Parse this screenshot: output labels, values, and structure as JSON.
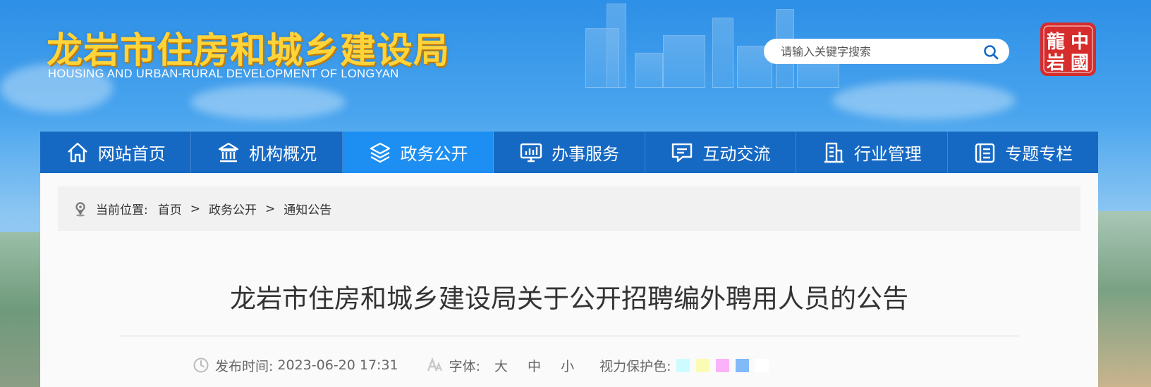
{
  "header": {
    "logo_cn": "龙岩市住房和城乡建设局",
    "logo_en": "HOUSING AND URBAN-RURAL DEVELOPMENT OF LONGYAN",
    "seal_text": [
      "龍",
      "中",
      "岩",
      "國"
    ]
  },
  "search": {
    "placeholder": "请输入关键字搜索"
  },
  "nav": {
    "items": [
      {
        "label": "网站首页",
        "icon": "home-icon"
      },
      {
        "label": "机构概况",
        "icon": "institution-icon"
      },
      {
        "label": "政务公开",
        "icon": "layers-icon",
        "active": true
      },
      {
        "label": "办事服务",
        "icon": "monitor-chart-icon"
      },
      {
        "label": "互动交流",
        "icon": "chat-icon"
      },
      {
        "label": "行业管理",
        "icon": "building-icon"
      },
      {
        "label": "专题专栏",
        "icon": "document-list-icon"
      }
    ]
  },
  "breadcrumb": {
    "prefix": "当前位置:",
    "items": [
      "首页",
      "政务公开",
      "通知公告"
    ],
    "separator": ">"
  },
  "article": {
    "title": "龙岩市住房和城乡建设局关于公开招聘编外聘用人员的公告",
    "publish_label": "发布时间:",
    "publish_time": "2023-06-20 17:31",
    "font_label": "字体:",
    "font_sizes": [
      "大",
      "中",
      "小"
    ],
    "eye_label": "视力保护色:",
    "eye_colors": [
      "#ccfcff",
      "#fafcb6",
      "#fcb2f8",
      "#82b9f8",
      "#ffffff"
    ]
  },
  "colors": {
    "nav_bg": "#1669c3",
    "nav_active": "#1d8ff2",
    "logo_yellow": "#ffd43a",
    "seal_red": "#d72c2c"
  }
}
